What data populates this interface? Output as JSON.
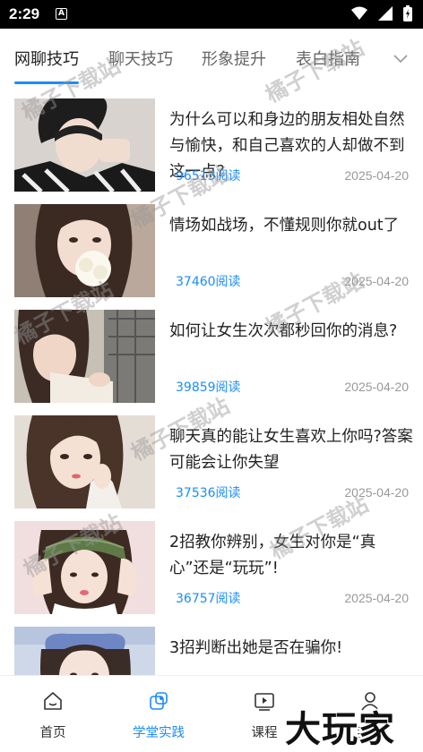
{
  "status": {
    "time": "2:29",
    "notif_badge": "A"
  },
  "tabs": [
    {
      "label": "网聊技巧",
      "active": true
    },
    {
      "label": "聊天技巧",
      "active": false
    },
    {
      "label": "形象提升",
      "active": false
    },
    {
      "label": "表白指南",
      "active": false
    }
  ],
  "articles": [
    {
      "title": "为什么可以和身边的朋友相处自然与愉快，和自己喜欢的人却做不到这一点?",
      "reads": "96513阅读",
      "date": "2025-04-20"
    },
    {
      "title": "情场如战场，不懂规则你就out了",
      "reads": "37460阅读",
      "date": "2025-04-20"
    },
    {
      "title": "如何让女生次次都秒回你的消息?",
      "reads": "39859阅读",
      "date": "2025-04-20"
    },
    {
      "title": "聊天真的能让女生喜欢上你吗?答案可能会让你失望",
      "reads": "37536阅读",
      "date": "2025-04-20"
    },
    {
      "title": "2招教你辨别，女生对你是“真心”还是“玩玩”!",
      "reads": "36757阅读",
      "date": "2025-04-20"
    },
    {
      "title": "3招判断出她是否在骗你!",
      "reads": "",
      "date": ""
    }
  ],
  "nav": [
    {
      "label": "首页",
      "icon": "home-icon"
    },
    {
      "label": "学堂实践",
      "icon": "practice-icon"
    },
    {
      "label": "课程",
      "icon": "play-icon"
    },
    {
      "label": "我的",
      "icon": "profile-icon"
    }
  ],
  "watermark": "橘子下载站",
  "brand_watermark": "大玩家",
  "colors": {
    "accent": "#1a8cff",
    "date": "#999999",
    "title": "#222222"
  }
}
